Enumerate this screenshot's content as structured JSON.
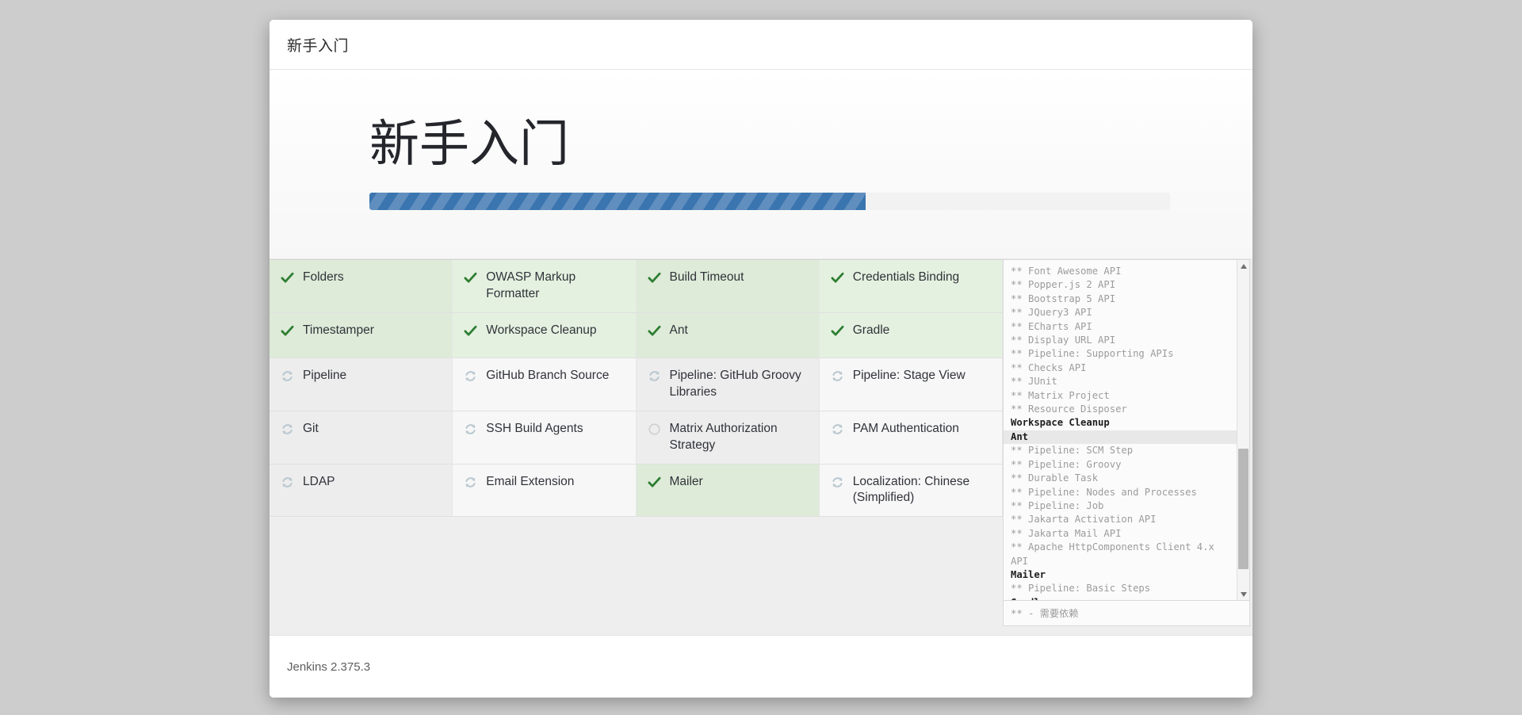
{
  "header": {
    "title": "新手入门"
  },
  "hero": {
    "title": "新手入门",
    "progress_percent": 62,
    "progress_fill_color": "#3b75b0",
    "progress_track_color": "#f2f2f2"
  },
  "plugins": {
    "columns": 4,
    "status_colors": {
      "success": "#2e7d32",
      "in_progress": "#b9c7cf",
      "pending": "#cfcfcf"
    },
    "items": [
      {
        "label": "Folders",
        "status": "success",
        "icon": "check-icon"
      },
      {
        "label": "OWASP Markup Formatter",
        "status": "success",
        "icon": "check-icon"
      },
      {
        "label": "Build Timeout",
        "status": "success",
        "icon": "check-icon"
      },
      {
        "label": "Credentials Binding",
        "status": "success",
        "icon": "check-icon"
      },
      {
        "label": "Timestamper",
        "status": "success",
        "icon": "check-icon"
      },
      {
        "label": "Workspace Cleanup",
        "status": "success",
        "icon": "check-icon"
      },
      {
        "label": "Ant",
        "status": "success",
        "icon": "check-icon"
      },
      {
        "label": "Gradle",
        "status": "success",
        "icon": "check-icon"
      },
      {
        "label": "Pipeline",
        "status": "in_progress",
        "icon": "refresh-icon"
      },
      {
        "label": "GitHub Branch Source",
        "status": "in_progress",
        "icon": "refresh-icon"
      },
      {
        "label": "Pipeline: GitHub Groovy Libraries",
        "status": "in_progress",
        "icon": "refresh-icon"
      },
      {
        "label": "Pipeline: Stage View",
        "status": "in_progress",
        "icon": "refresh-icon"
      },
      {
        "label": "Git",
        "status": "in_progress",
        "icon": "refresh-icon"
      },
      {
        "label": "SSH Build Agents",
        "status": "in_progress",
        "icon": "refresh-icon"
      },
      {
        "label": "Matrix Authorization Strategy",
        "status": "pending",
        "icon": "circle-icon"
      },
      {
        "label": "PAM Authentication",
        "status": "in_progress",
        "icon": "refresh-icon"
      },
      {
        "label": "LDAP",
        "status": "in_progress",
        "icon": "refresh-icon"
      },
      {
        "label": "Email Extension",
        "status": "in_progress",
        "icon": "refresh-icon"
      },
      {
        "label": "Mailer",
        "status": "success",
        "icon": "check-icon"
      },
      {
        "label": "Localization: Chinese (Simplified)",
        "status": "in_progress",
        "icon": "refresh-icon"
      }
    ]
  },
  "log": {
    "lines": [
      {
        "text": "** Font Awesome API",
        "kind": "dependency"
      },
      {
        "text": "** Popper.js 2 API",
        "kind": "dependency"
      },
      {
        "text": "** Bootstrap 5 API",
        "kind": "dependency"
      },
      {
        "text": "** JQuery3 API",
        "kind": "dependency"
      },
      {
        "text": "** ECharts API",
        "kind": "dependency"
      },
      {
        "text": "** Display URL API",
        "kind": "dependency"
      },
      {
        "text": "** Pipeline: Supporting APIs",
        "kind": "dependency"
      },
      {
        "text": "** Checks API",
        "kind": "dependency"
      },
      {
        "text": "** JUnit",
        "kind": "dependency"
      },
      {
        "text": "** Matrix Project",
        "kind": "dependency"
      },
      {
        "text": "** Resource Disposer",
        "kind": "dependency"
      },
      {
        "text": "Workspace Cleanup",
        "kind": "plugin"
      },
      {
        "text": "Ant",
        "kind": "plugin-active"
      },
      {
        "text": "** Pipeline: SCM Step",
        "kind": "dependency"
      },
      {
        "text": "** Pipeline: Groovy",
        "kind": "dependency"
      },
      {
        "text": "** Durable Task",
        "kind": "dependency"
      },
      {
        "text": "** Pipeline: Nodes and Processes",
        "kind": "dependency"
      },
      {
        "text": "** Pipeline: Job",
        "kind": "dependency"
      },
      {
        "text": "** Jakarta Activation API",
        "kind": "dependency"
      },
      {
        "text": "** Jakarta Mail API",
        "kind": "dependency"
      },
      {
        "text": "** Apache HttpComponents Client 4.x API",
        "kind": "dependency"
      },
      {
        "text": "Mailer",
        "kind": "plugin"
      },
      {
        "text": "** Pipeline: Basic Steps",
        "kind": "dependency"
      },
      {
        "text": "Gradle",
        "kind": "plugin"
      }
    ],
    "footnote": "** - 需要依赖"
  },
  "footer": {
    "version": "Jenkins 2.375.3"
  }
}
